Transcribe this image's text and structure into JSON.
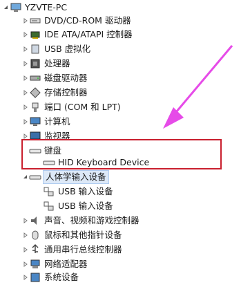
{
  "tree": {
    "root": {
      "label": "YZVTE-PC",
      "icon": "computer-icon"
    },
    "items": [
      {
        "label": "DVD/CD-ROM 驱动器",
        "icon": "dvd-drive-icon"
      },
      {
        "label": "IDE ATA/ATAPI 控制器",
        "icon": "ide-controller-icon"
      },
      {
        "label": "USB 虚拟化",
        "icon": "usb-icon"
      },
      {
        "label": "处理器",
        "icon": "processor-icon"
      },
      {
        "label": "磁盘驱动器",
        "icon": "disk-drive-icon"
      },
      {
        "label": "存储控制器",
        "icon": "storage-controller-icon"
      },
      {
        "label": "端口 (COM 和 LPT)",
        "icon": "port-icon"
      },
      {
        "label": "计算机",
        "icon": "computer-icon"
      },
      {
        "label": "监视器",
        "icon": "monitor-icon"
      },
      {
        "label": "键盘",
        "icon": "keyboard-icon",
        "expanded": true
      },
      {
        "label": "HID Keyboard Device",
        "icon": "keyboard-icon",
        "child": true
      },
      {
        "label": "人体学输入设备",
        "icon": "hid-icon",
        "selected": true
      },
      {
        "label": "USB 输入设备",
        "icon": "usb-input-device-icon",
        "child": true
      },
      {
        "label": "USB 输入设备",
        "icon": "usb-input-device-icon",
        "child": true
      },
      {
        "label": "声音、视频和游戏控制器",
        "icon": "sound-icon"
      },
      {
        "label": "鼠标和其他指针设备",
        "icon": "mouse-icon"
      },
      {
        "label": "通用串行总线控制器",
        "icon": "usb-controller-icon"
      },
      {
        "label": "网络适配器",
        "icon": "network-adapter-icon"
      },
      {
        "label": "系统设备",
        "icon": "system-device-icon"
      }
    ]
  },
  "annotation": {
    "highlight_color": "#c91f2e",
    "arrow_color": "#e64be8"
  }
}
